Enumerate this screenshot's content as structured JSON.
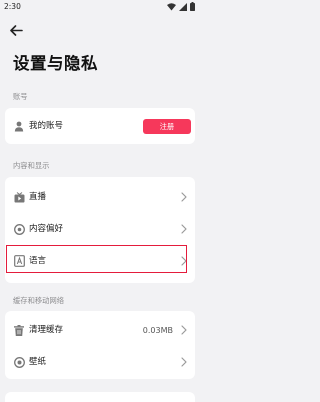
{
  "status_bar": {
    "time": "2:30"
  },
  "header": {
    "title": "设置与隐私"
  },
  "sections": {
    "account": {
      "label": "账号",
      "my_account": "我的账号",
      "register": "注册"
    },
    "content": {
      "label": "内容和显示",
      "live": "直播",
      "preferences": "内容偏好",
      "language": "语言"
    },
    "cache": {
      "label": "缓存和移动网络",
      "clear_cache": "清理缓存",
      "cache_size": "0.03MB",
      "wallpaper": "壁纸"
    }
  },
  "colors": {
    "accent": "#f6385b",
    "highlight": "#e41c3c",
    "background": "#f2f2f4"
  }
}
